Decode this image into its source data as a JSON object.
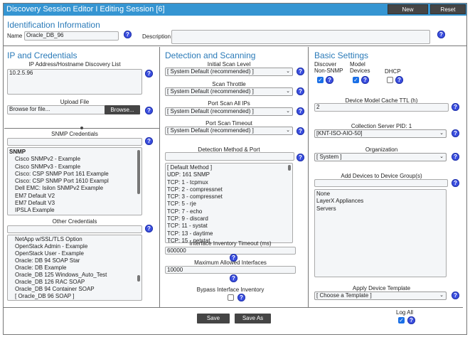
{
  "header": {
    "title": "Discovery Session Editor I Editing Session [6]",
    "new_label": "New",
    "reset_label": "Reset"
  },
  "identification": {
    "heading": "Identification Information",
    "name_label": "Name",
    "name_value": "Oracle_DB_96",
    "description_label": "Description",
    "description_value": ""
  },
  "ip": {
    "heading": "IP and Credentials",
    "discovery_label": "IP Address/Hostname Discovery List",
    "discovery_value": "10.2.5.96",
    "upload_label": "Upload File",
    "upload_placeholder": "Browse for file...",
    "browse_label": "Browse...",
    "snmp_label": "SNMP Credentials",
    "snmp_items": [
      "SNMP",
      "Cisco SNMPv2 - Example",
      "Cisco SNMPv3 - Example",
      "Cisco: CSP SNMP Port 161 Example",
      "Cisco: CSP SNMP Port 1610 Exampl",
      "Dell EMC: Isilon SNMPv2 Example",
      "EM7 Default V2",
      "EM7 Default V3",
      "IPSLA Example"
    ],
    "other_label": "Other Credentials",
    "other_items": [
      "NetApp w/SSL/TLS Option",
      "OpenStack Admin - Example",
      "OpenStack User - Example",
      "Oracle: DB 94 SOAP Star",
      "Oracle: DB Example",
      "Oracle_DB 125 Windows_Auto_Test",
      "Oracle_DB 126 RAC SOAP",
      "Oracle_DB 94 Container SOAP",
      "[ Oracle_DB 96 SOAP ]"
    ]
  },
  "detection": {
    "heading": "Detection and Scanning",
    "initial_scan_label": "Initial Scan Level",
    "initial_scan_value": "[ System Default (recommended) ]",
    "throttle_label": "Scan Throttle",
    "throttle_value": "[ System Default (recommended) ]",
    "port_all_label": "Port Scan All IPs",
    "port_all_value": "[ System Default (recommended) ]",
    "port_timeout_label": "Port Scan Timeout",
    "port_timeout_value": "[ System Default (recommended) ]",
    "method_label": "Detection Method & Port",
    "methods": [
      "[ Default Method ]",
      "UDP: 161 SNMP",
      "TCP: 1 - tcpmux",
      "TCP: 2 - compressnet",
      "TCP: 3 - compressnet",
      "TCP: 5 - rje",
      "TCP: 7 - echo",
      "TCP: 9 - discard",
      "TCP: 11 - systat",
      "TCP: 13 - daytime",
      "TCP: 15 - netstat"
    ],
    "iface_timeout_label": "Interface Inventory Timeout (ms)",
    "iface_timeout_value": "600000",
    "max_iface_label": "Maximum Allowed Interfaces",
    "max_iface_value": "10000",
    "bypass_label": "Bypass Interface Inventory",
    "bypass_checked": false
  },
  "basic": {
    "heading": "Basic Settings",
    "discover_label1": "Discover",
    "discover_label2": "Non-SNMP",
    "discover_checked": true,
    "model_label1": "Model",
    "model_label2": "Devices",
    "model_checked": true,
    "dhcp_label": "DHCP",
    "dhcp_checked": false,
    "cache_label": "Device Model Cache TTL (h)",
    "cache_value": "2",
    "collector_label": "Collection Server PID: 1",
    "collector_value": "[KNT-ISO-AIO-50]",
    "org_label": "Organization",
    "org_value": "[ System ]",
    "group_label": "Add Devices to Device Group(s)",
    "groups": [
      "None",
      "LayerX Appliances",
      "Servers"
    ],
    "template_label": "Apply Device Template",
    "template_value": "[ Choose a Template ]"
  },
  "footer": {
    "save_label": "Save",
    "save_as_label": "Save As",
    "log_all_label": "Log All",
    "log_all_checked": true
  }
}
